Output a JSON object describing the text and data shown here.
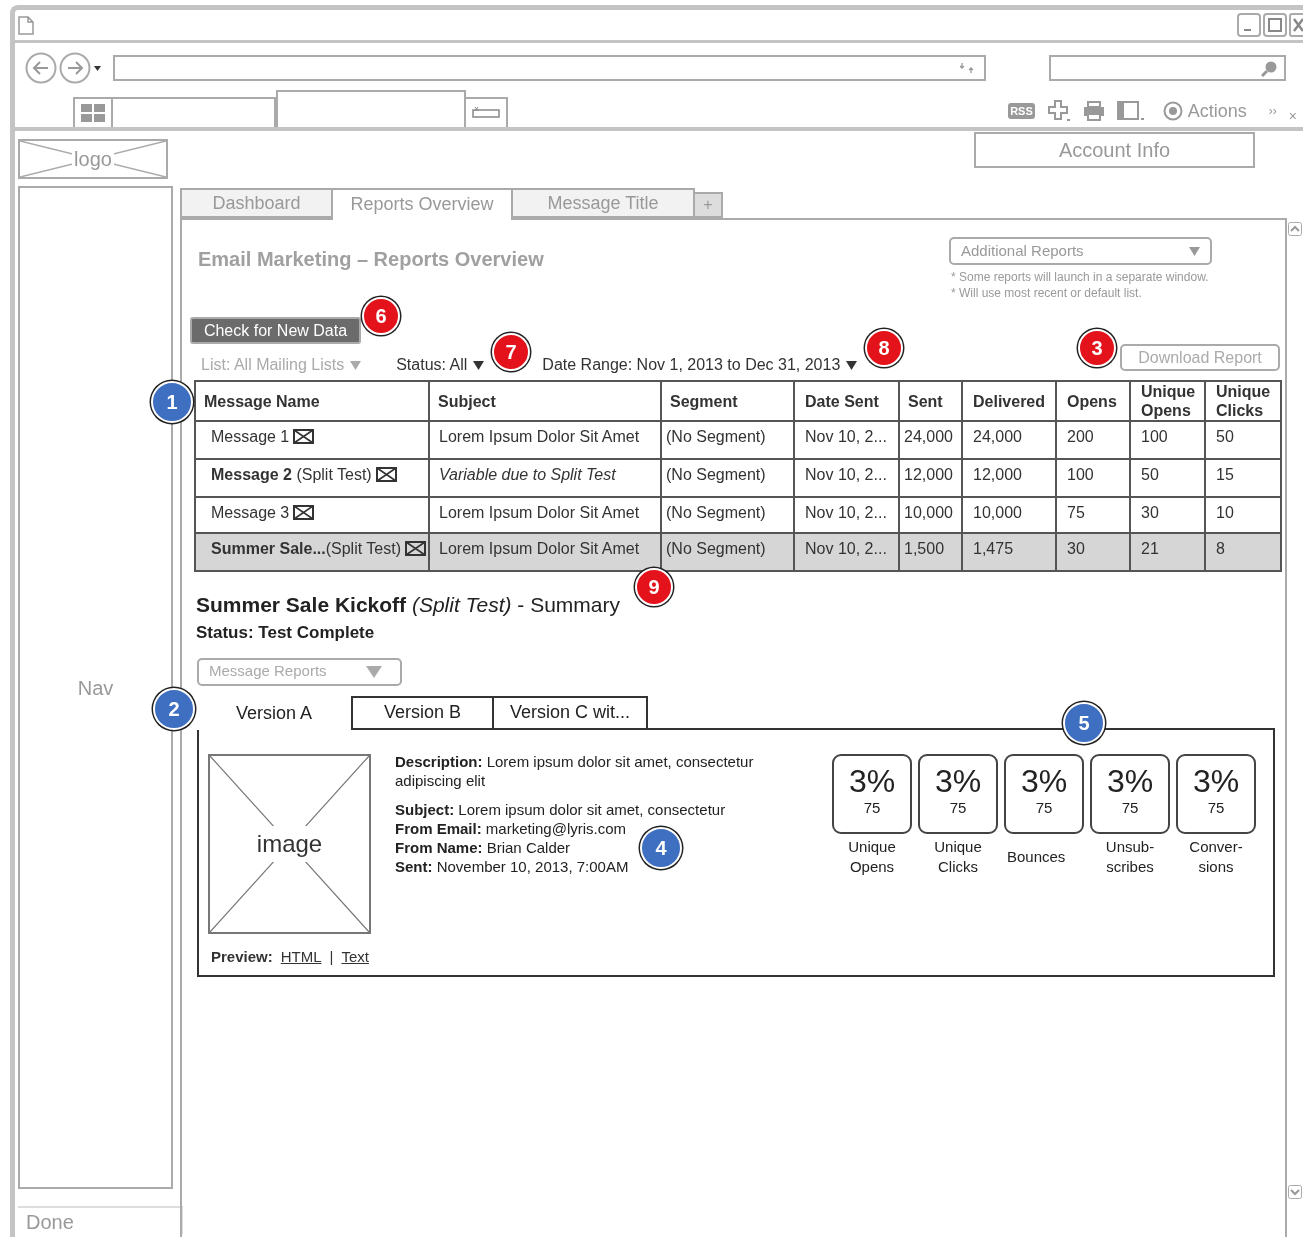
{
  "browser": {
    "rss": "RSS",
    "actions": "Actions",
    "overflow": "››",
    "close_tab": "×"
  },
  "logo": "logo",
  "account": "Account Info",
  "nav": "Nav",
  "status_bar": "Done",
  "tabs": [
    {
      "label": "Dashboard",
      "selected": false
    },
    {
      "label": "Reports Overview",
      "selected": true
    },
    {
      "label": "Message Title",
      "selected": false
    }
  ],
  "add_tab": "+",
  "page_title": "Email Marketing – Reports Overview",
  "additional_reports": "Additional Reports",
  "notes": [
    "* Some reports will launch in a separate window.",
    "* Will use most recent or default list."
  ],
  "check_button": "Check for New Data",
  "filters": [
    {
      "label": "List: All Mailing Lists",
      "disabled": true
    },
    {
      "label": "Status: All",
      "disabled": false
    },
    {
      "label": "Date Range: Nov 1, 2013 to Dec 31, 2013",
      "disabled": false
    }
  ],
  "download_button": "Download Report",
  "table": {
    "columns": [
      "Message Name",
      "Subject",
      "Segment",
      "Date Sent",
      "Sent",
      "Delivered",
      "Opens",
      "Unique Opens",
      "Unique Clicks"
    ],
    "rows": [
      {
        "selected": false,
        "subject_italic": false,
        "cells": [
          "Message 1",
          "Lorem Ipsum Dolor Sit Amet",
          "(No Segment)",
          "Nov 10, 2...",
          "24,000",
          "24,000",
          "200",
          "100",
          "50"
        ]
      },
      {
        "selected": false,
        "subject_italic": true,
        "cells": [
          "**Message 2** (Split Test)",
          "Variable due to Split Test",
          "(No Segment)",
          "Nov 10, 2...",
          "12,000",
          "12,000",
          "100",
          "50",
          "15"
        ]
      },
      {
        "selected": false,
        "subject_italic": false,
        "cells": [
          "Message 3",
          "Lorem Ipsum Dolor Sit Amet",
          "(No Segment)",
          "Nov 10, 2...",
          "10,000",
          "10,000",
          "75",
          "30",
          "10"
        ]
      },
      {
        "selected": true,
        "subject_italic": false,
        "cells": [
          "**Summer Sale...**(Split Test)",
          "Lorem Ipsum Dolor Sit Amet",
          "(No Segment)",
          "Nov 10, 2...",
          "1,500",
          "1,475",
          "30",
          "21",
          "8"
        ]
      }
    ]
  },
  "summary": {
    "title": "**Summer Sale Kickoff** *(Split Test)* - Summary",
    "status": "Status: Test Complete",
    "reports_dropdown": "Message Reports"
  },
  "version_tabs": [
    {
      "label": "Version A",
      "selected": true
    },
    {
      "label": "Version B",
      "selected": false
    },
    {
      "label": "Version C wit...",
      "selected": false
    }
  ],
  "version": {
    "image_label": "image",
    "details": [
      "**Description:** Lorem ipsum dolor sit amet, consectetur adipiscing elit",
      "**Subject:** Lorem ipsum dolor sit amet, consectetur",
      "**From Email:** marketing@lyris.com",
      "**From Name:** Brian Calder",
      "**Sent:** November 10, 2013, 7:00AM"
    ],
    "preview_label": "Preview:",
    "preview_links": [
      "HTML",
      "Text"
    ],
    "separator": "|"
  },
  "stats": [
    {
      "percent": "3%",
      "count": "75",
      "label": "Unique Opens"
    },
    {
      "percent": "3%",
      "count": "75",
      "label": "Unique Clicks"
    },
    {
      "percent": "3%",
      "count": "75",
      "label": "Bounces"
    },
    {
      "percent": "3%",
      "count": "75",
      "label": "Unsub-scribes"
    },
    {
      "percent": "3%",
      "count": "75",
      "label": "Conver-sions"
    }
  ],
  "callouts": [
    {
      "number": "1",
      "color": "#3f6fc0"
    },
    {
      "number": "2",
      "color": "#3f6fc0"
    },
    {
      "number": "3",
      "color": "#e3121b"
    },
    {
      "number": "4",
      "color": "#3f6fc0"
    },
    {
      "number": "5",
      "color": "#3f6fc0"
    },
    {
      "number": "6",
      "color": "#e3121b"
    },
    {
      "number": "7",
      "color": "#e3121b"
    },
    {
      "number": "8",
      "color": "#e3121b"
    },
    {
      "number": "9",
      "color": "#e3121b"
    }
  ]
}
